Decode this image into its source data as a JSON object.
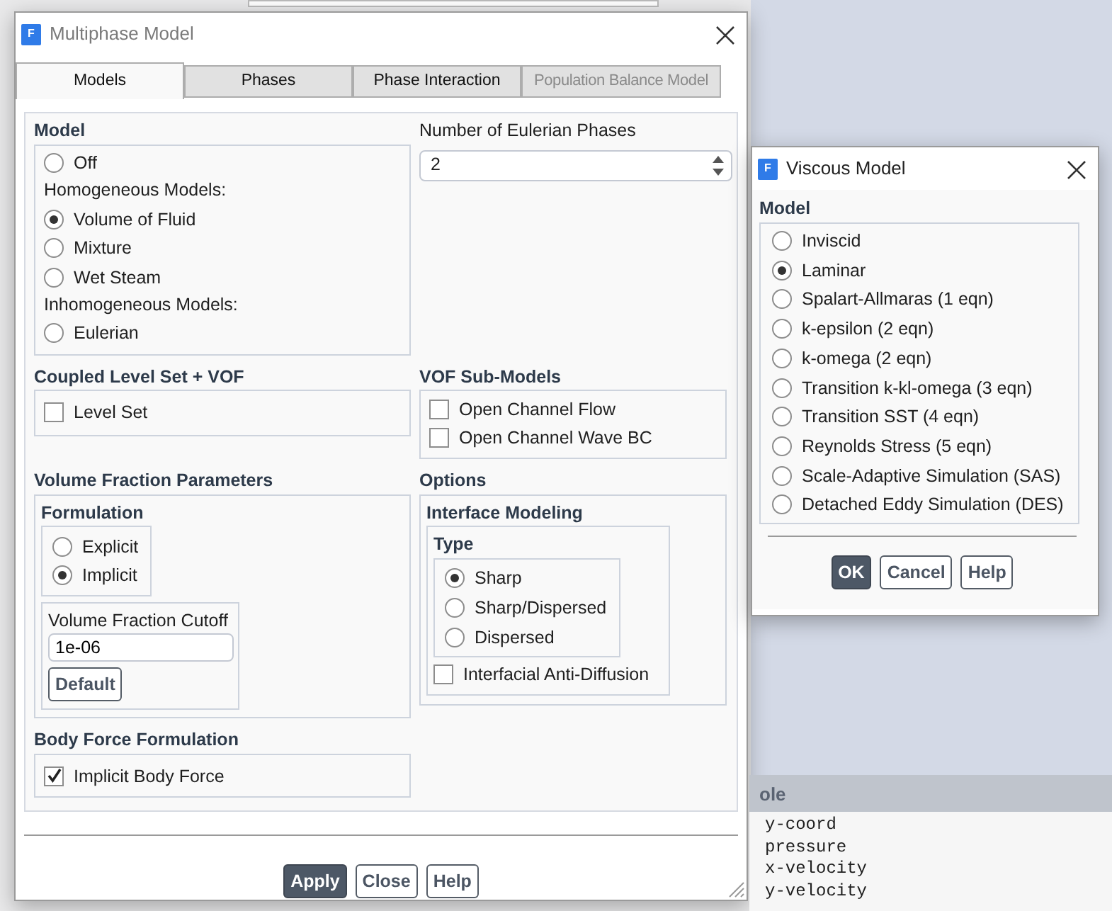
{
  "multiphase": {
    "logo": "F",
    "title": "Multiphase Model",
    "tabs": [
      {
        "label": "Models",
        "selected": true,
        "disabled": false
      },
      {
        "label": "Phases",
        "selected": false,
        "disabled": false
      },
      {
        "label": "Phase Interaction",
        "selected": false,
        "disabled": false
      },
      {
        "label": "Population Balance Model",
        "selected": false,
        "disabled": true
      }
    ],
    "model": {
      "title": "Model",
      "items": [
        {
          "kind": "radio",
          "label": "Off",
          "selected": false
        },
        {
          "kind": "heading",
          "label": "Homogeneous Models:"
        },
        {
          "kind": "radio",
          "label": "Volume of Fluid",
          "selected": true
        },
        {
          "kind": "radio",
          "label": "Mixture",
          "selected": false
        },
        {
          "kind": "radio",
          "label": "Wet Steam",
          "selected": false
        },
        {
          "kind": "heading",
          "label": "Inhomogeneous Models:"
        },
        {
          "kind": "radio",
          "label": "Eulerian",
          "selected": false
        }
      ]
    },
    "eulerian_phases": {
      "label": "Number of Eulerian Phases",
      "value": "2"
    },
    "coupled_level_set": {
      "title": "Coupled Level Set + VOF",
      "checkboxes": [
        {
          "label": "Level Set",
          "checked": false
        }
      ]
    },
    "vof_submodels": {
      "title": "VOF Sub-Models",
      "checkboxes": [
        {
          "label": "Open Channel Flow",
          "checked": false
        },
        {
          "label": "Open Channel Wave BC",
          "checked": false
        }
      ]
    },
    "volume_fraction_parameters": {
      "title": "Volume Fraction Parameters",
      "formulation": {
        "title": "Formulation",
        "options": [
          {
            "label": "Explicit",
            "selected": false
          },
          {
            "label": "Implicit",
            "selected": true
          }
        ]
      },
      "cutoff": {
        "label": "Volume Fraction Cutoff",
        "value": "1e-06",
        "button": "Default"
      }
    },
    "options": {
      "title": "Options",
      "interface_modeling": {
        "title": "Interface Modeling",
        "type_title": "Type",
        "options": [
          {
            "label": "Sharp",
            "selected": true
          },
          {
            "label": "Sharp/Dispersed",
            "selected": false
          },
          {
            "label": "Dispersed",
            "selected": false
          }
        ],
        "checkbox": {
          "label": "Interfacial Anti-Diffusion",
          "checked": false
        }
      }
    },
    "body_force": {
      "title": "Body Force Formulation",
      "checkboxes": [
        {
          "label": "Implicit Body Force",
          "checked": true
        }
      ]
    },
    "buttons": [
      {
        "label": "Apply",
        "primary": true
      },
      {
        "label": "Close",
        "primary": false
      },
      {
        "label": "Help",
        "primary": false
      }
    ]
  },
  "viscous": {
    "logo": "F",
    "title": "Viscous Model",
    "model_title": "Model",
    "options": [
      {
        "label": "Inviscid",
        "selected": false
      },
      {
        "label": "Laminar",
        "selected": true
      },
      {
        "label": "Spalart-Allmaras (1 eqn)",
        "selected": false
      },
      {
        "label": "k-epsilon (2 eqn)",
        "selected": false
      },
      {
        "label": "k-omega (2 eqn)",
        "selected": false
      },
      {
        "label": "Transition k-kl-omega (3 eqn)",
        "selected": false
      },
      {
        "label": "Transition SST (4 eqn)",
        "selected": false
      },
      {
        "label": "Reynolds Stress (5 eqn)",
        "selected": false
      },
      {
        "label": "Scale-Adaptive Simulation (SAS)",
        "selected": false
      },
      {
        "label": "Detached Eddy Simulation (DES)",
        "selected": false
      }
    ],
    "buttons": [
      {
        "label": "OK",
        "primary": true
      },
      {
        "label": "Cancel",
        "primary": false
      },
      {
        "label": "Help",
        "primary": false
      }
    ]
  },
  "console": {
    "header": "ole",
    "lines": [
      "y-coord",
      "pressure",
      "x-velocity",
      "y-velocity"
    ]
  }
}
